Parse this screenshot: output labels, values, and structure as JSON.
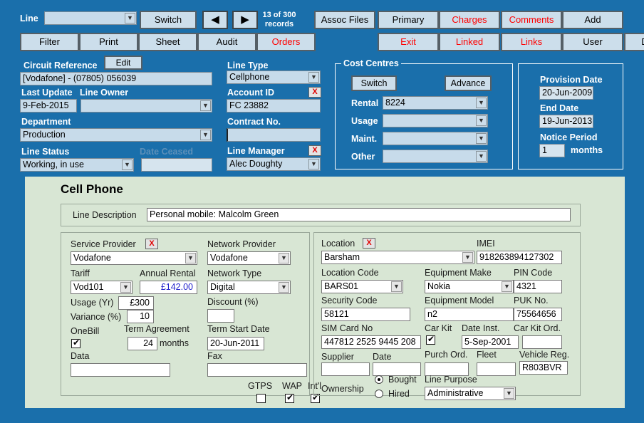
{
  "toolbar": {
    "line_label": "Line",
    "line_value": "",
    "switch_label": "Switch",
    "prev_icon": "◀",
    "next_icon": "▶",
    "record_count": "13  of  300",
    "record_count_sub": "records",
    "row1": [
      {
        "label": "Assoc Files",
        "red": false
      },
      {
        "label": "Primary",
        "red": false
      },
      {
        "label": "Charges",
        "red": true
      },
      {
        "label": "Comments",
        "red": true
      },
      {
        "label": "Add",
        "red": false
      }
    ],
    "row2": [
      {
        "label": "Filter",
        "red": false
      },
      {
        "label": "Print",
        "red": false
      },
      {
        "label": "Sheet",
        "red": false
      },
      {
        "label": "Audit",
        "red": false
      },
      {
        "label": "Orders",
        "red": true
      },
      {
        "label": "Exit",
        "red": true
      },
      {
        "label": "Linked",
        "red": true
      },
      {
        "label": "Links",
        "red": true
      },
      {
        "label": "User",
        "red": false
      },
      {
        "label": "Delete",
        "red": false
      }
    ]
  },
  "header": {
    "circuit_reference_label": "Circuit Reference",
    "edit_label": "Edit",
    "circuit_reference_value": "[Vodafone] - (07805) 056039",
    "last_update_label": "Last Update",
    "last_update_value": "9-Feb-2015",
    "line_owner_label": "Line Owner",
    "line_owner_value": "",
    "department_label": "Department",
    "department_value": "Production",
    "line_status_label": "Line Status",
    "line_status_value": "Working, in use",
    "date_ceased_label": "Date Ceased",
    "date_ceased_value": "",
    "line_type_label": "Line Type",
    "line_type_value": "Cellphone",
    "account_id_label": "Account ID",
    "account_id_value": "FC 23882",
    "contract_no_label": "Contract No.",
    "contract_no_value": "",
    "line_manager_label": "Line Manager",
    "line_manager_value": "Alec Doughty",
    "clear_icon": "X"
  },
  "cost_centres": {
    "title": "Cost Centres",
    "switch_label": "Switch",
    "advance_label": "Advance",
    "rows": [
      {
        "label": "Rental",
        "value": "8224"
      },
      {
        "label": "Usage",
        "value": ""
      },
      {
        "label": "Maint.",
        "value": ""
      },
      {
        "label": "Other",
        "value": ""
      }
    ]
  },
  "dates": {
    "provision_date_label": "Provision Date",
    "provision_date_value": "20-Jun-2009",
    "end_date_label": "End Date",
    "end_date_value": "19-Jun-2013",
    "notice_period_label": "Notice Period",
    "notice_period_value": "1",
    "notice_period_units": "months"
  },
  "cellphone": {
    "title": "Cell Phone",
    "line_description_label": "Line Description",
    "line_description_value": "Personal mobile: Malcolm Green",
    "left": {
      "service_provider_label": "Service Provider",
      "service_provider_value": "Vodafone",
      "clear_icon": "X",
      "tariff_label": "Tariff",
      "tariff_value": "Vod101",
      "annual_rental_label": "Annual Rental",
      "annual_rental_value": "£142.00",
      "usage_yr_label": "Usage (Yr)",
      "usage_yr_value": "£300",
      "variance_label": "Variance (%)",
      "variance_value": "10",
      "onebill_label": "OneBill",
      "onebill_checked": true,
      "term_agreement_label": "Term Agreement",
      "term_agreement_value": "24",
      "term_agreement_units": "months",
      "data_label": "Data",
      "data_value": "",
      "network_provider_label": "Network Provider",
      "network_provider_value": "Vodafone",
      "network_type_label": "Network Type",
      "network_type_value": "Digital",
      "discount_label": "Discount (%)",
      "discount_value": "",
      "term_start_date_label": "Term Start Date",
      "term_start_date_value": "20-Jun-2011",
      "fax_label": "Fax",
      "fax_value": "",
      "gtps_label": "GTPS",
      "gtps_checked": false,
      "wap_label": "WAP",
      "wap_checked": true,
      "intl_label": "Int'l",
      "intl_checked": true
    },
    "right": {
      "location_label": "Location",
      "location_value": "Barsham",
      "clear_icon": "X",
      "imei_label": "IMEI",
      "imei_value": "918263894127302",
      "location_code_label": "Location Code",
      "location_code_value": "BARS01",
      "equipment_make_label": "Equipment Make",
      "equipment_make_value": "Nokia",
      "pin_code_label": "PIN Code",
      "pin_code_value": "4321",
      "security_code_label": "Security Code",
      "security_code_value": "58121",
      "equipment_model_label": "Equipment Model",
      "equipment_model_value": "n2",
      "puk_no_label": "PUK No.",
      "puk_no_value": "75564656",
      "sim_card_no_label": "SIM Card No",
      "sim_card_no_value": "447812 2525 9445 208",
      "car_kit_label": "Car Kit",
      "car_kit_checked": true,
      "date_inst_label": "Date Inst.",
      "date_inst_value": "5-Sep-2001",
      "car_kit_ord_label": "Car Kit Ord.",
      "car_kit_ord_value": "",
      "supplier_label": "Supplier",
      "supplier_value": "",
      "date_label": "Date",
      "date_value": "",
      "purch_ord_label": "Purch Ord.",
      "purch_ord_value": "",
      "fleet_label": "Fleet",
      "fleet_value": "",
      "vehicle_reg_label": "Vehicle Reg.",
      "vehicle_reg_value": "R803BVR",
      "ownership_label": "Ownership",
      "ownership_bought_label": "Bought",
      "ownership_hired_label": "Hired",
      "ownership_selected": "Bought",
      "line_purpose_label": "Line Purpose",
      "line_purpose_value": "Administrative"
    }
  },
  "colors": {
    "background": "#1a6fab",
    "panel": "#d8e6d4",
    "field": "#c7dbea",
    "button": "#ccdeeb",
    "accent_red": "#ff0000",
    "accent_blue": "#2222cc"
  }
}
